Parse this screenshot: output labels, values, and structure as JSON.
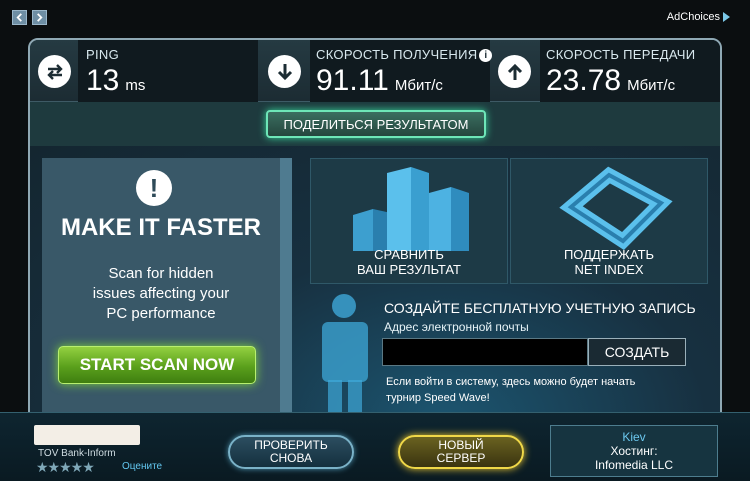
{
  "adbar": {
    "adchoices": "AdChoices"
  },
  "metrics": {
    "ping": {
      "label": "PING",
      "value": "13",
      "unit": "ms"
    },
    "download": {
      "label": "СКОРОСТЬ ПОЛУЧЕНИЯ",
      "value": "91.11",
      "unit": "Мбит/с"
    },
    "upload": {
      "label": "СКОРОСТЬ ПЕРЕДАЧИ",
      "value": "23.78",
      "unit": "Мбит/с"
    }
  },
  "share": {
    "label": "ПОДЕЛИТЬСЯ РЕЗУЛЬТАТОМ"
  },
  "promo": {
    "title": "MAKE IT FASTER",
    "line1": "Scan for hidden",
    "line2": "issues affecting your",
    "line3": "PC performance",
    "button": "START SCAN NOW"
  },
  "tiles": {
    "compare": {
      "line1": "СРАВНИТЬ",
      "line2": "ВАШ РЕЗУЛЬТАТ"
    },
    "support": {
      "line1": "ПОДДЕРЖАТЬ",
      "line2": "NET INDEX"
    }
  },
  "register": {
    "title": "СОЗДАЙТЕ БЕСПЛАТНУЮ УЧЕТНУЮ ЗАПИСЬ",
    "email_label": "Адрес электронной почты",
    "email_value": "",
    "create": "СОЗДАТЬ",
    "note_line1": "Если войти в систему, здесь можно будет начать",
    "note_line2": "турнир Speed Wave!"
  },
  "bottom": {
    "isp": "TOV Bank-Inform",
    "stars": "★★★★★",
    "rate": "Оцените",
    "retest_line1": "ПРОВЕРИТЬ",
    "retest_line2": "СНОВА",
    "newserver_line1": "НОВЫЙ",
    "newserver_line2": "СЕРВЕР",
    "server_city": "Kiev",
    "server_host_label": "Хостинг:",
    "server_host": "Infomedia LLC"
  }
}
